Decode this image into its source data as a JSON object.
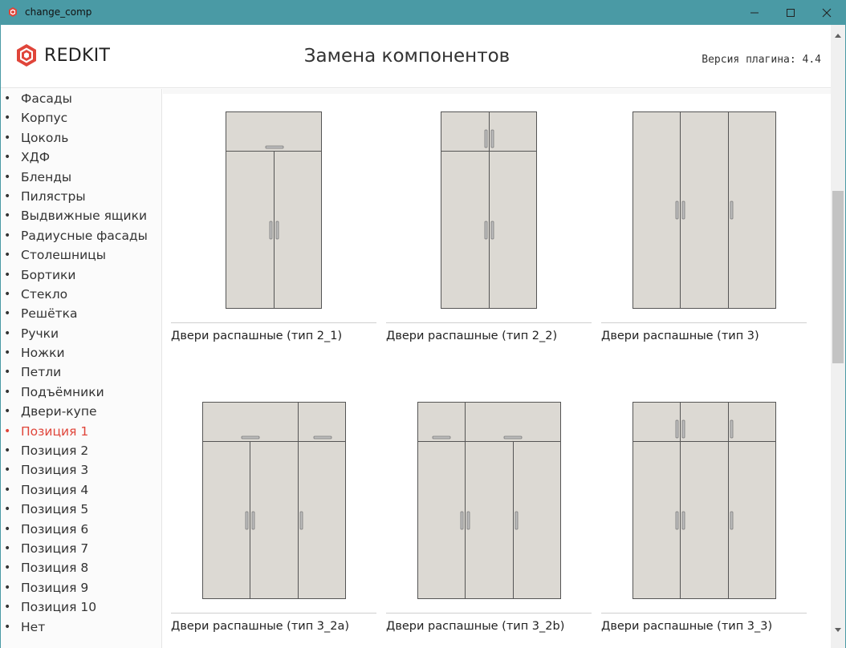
{
  "window": {
    "title": "change_comp",
    "minimize_icon": "minimize-icon",
    "maximize_icon": "maximize-icon",
    "close_icon": "close-icon"
  },
  "header": {
    "logo_text": "REDKIT",
    "logo_color": "#e0453a",
    "title": "Замена компонентов",
    "version": "Версия плагина: 4.4"
  },
  "sidebar": {
    "active_color": "#e0453a",
    "items": [
      {
        "label": "Фасады",
        "active": false
      },
      {
        "label": "Корпус",
        "active": false
      },
      {
        "label": "Цоколь",
        "active": false
      },
      {
        "label": "ХДФ",
        "active": false
      },
      {
        "label": "Бленды",
        "active": false
      },
      {
        "label": "Пилястры",
        "active": false
      },
      {
        "label": "Выдвижные ящики",
        "active": false
      },
      {
        "label": "Радиусные фасады",
        "active": false
      },
      {
        "label": "Столешницы",
        "active": false
      },
      {
        "label": "Бортики",
        "active": false
      },
      {
        "label": "Стекло",
        "active": false
      },
      {
        "label": "Решётка",
        "active": false
      },
      {
        "label": "Ручки",
        "active": false
      },
      {
        "label": "Ножки",
        "active": false
      },
      {
        "label": "Петли",
        "active": false
      },
      {
        "label": "Подъёмники",
        "active": false
      },
      {
        "label": "Двери-купе",
        "active": false
      },
      {
        "label": "Позиция 1",
        "active": true
      },
      {
        "label": "Позиция 2",
        "active": false
      },
      {
        "label": "Позиция 3",
        "active": false
      },
      {
        "label": "Позиция 4",
        "active": false
      },
      {
        "label": "Позиция 5",
        "active": false
      },
      {
        "label": "Позиция 6",
        "active": false
      },
      {
        "label": "Позиция 7",
        "active": false
      },
      {
        "label": "Позиция 8",
        "active": false
      },
      {
        "label": "Позиция 9",
        "active": false
      },
      {
        "label": "Позиция 10",
        "active": false
      },
      {
        "label": "Нет",
        "active": false
      }
    ]
  },
  "components": [
    {
      "caption": "Двери распашные (тип 2_1)",
      "icon": "wardrobe-2-1-image"
    },
    {
      "caption": "Двери распашные (тип 2_2)",
      "icon": "wardrobe-2-2-image"
    },
    {
      "caption": "Двери распашные (тип 3)",
      "icon": "wardrobe-3-image"
    },
    {
      "caption": "Двери распашные (тип 3_2a)",
      "icon": "wardrobe-3-2a-image"
    },
    {
      "caption": "Двери распашные (тип 3_2b)",
      "icon": "wardrobe-3-2b-image"
    },
    {
      "caption": "Двери распашные (тип 3_3)",
      "icon": "wardrobe-3-3-image"
    }
  ],
  "colors": {
    "titlebar": "#4a9aa5",
    "panel_fill": "#dcd9d3",
    "panel_stroke": "#555555"
  }
}
